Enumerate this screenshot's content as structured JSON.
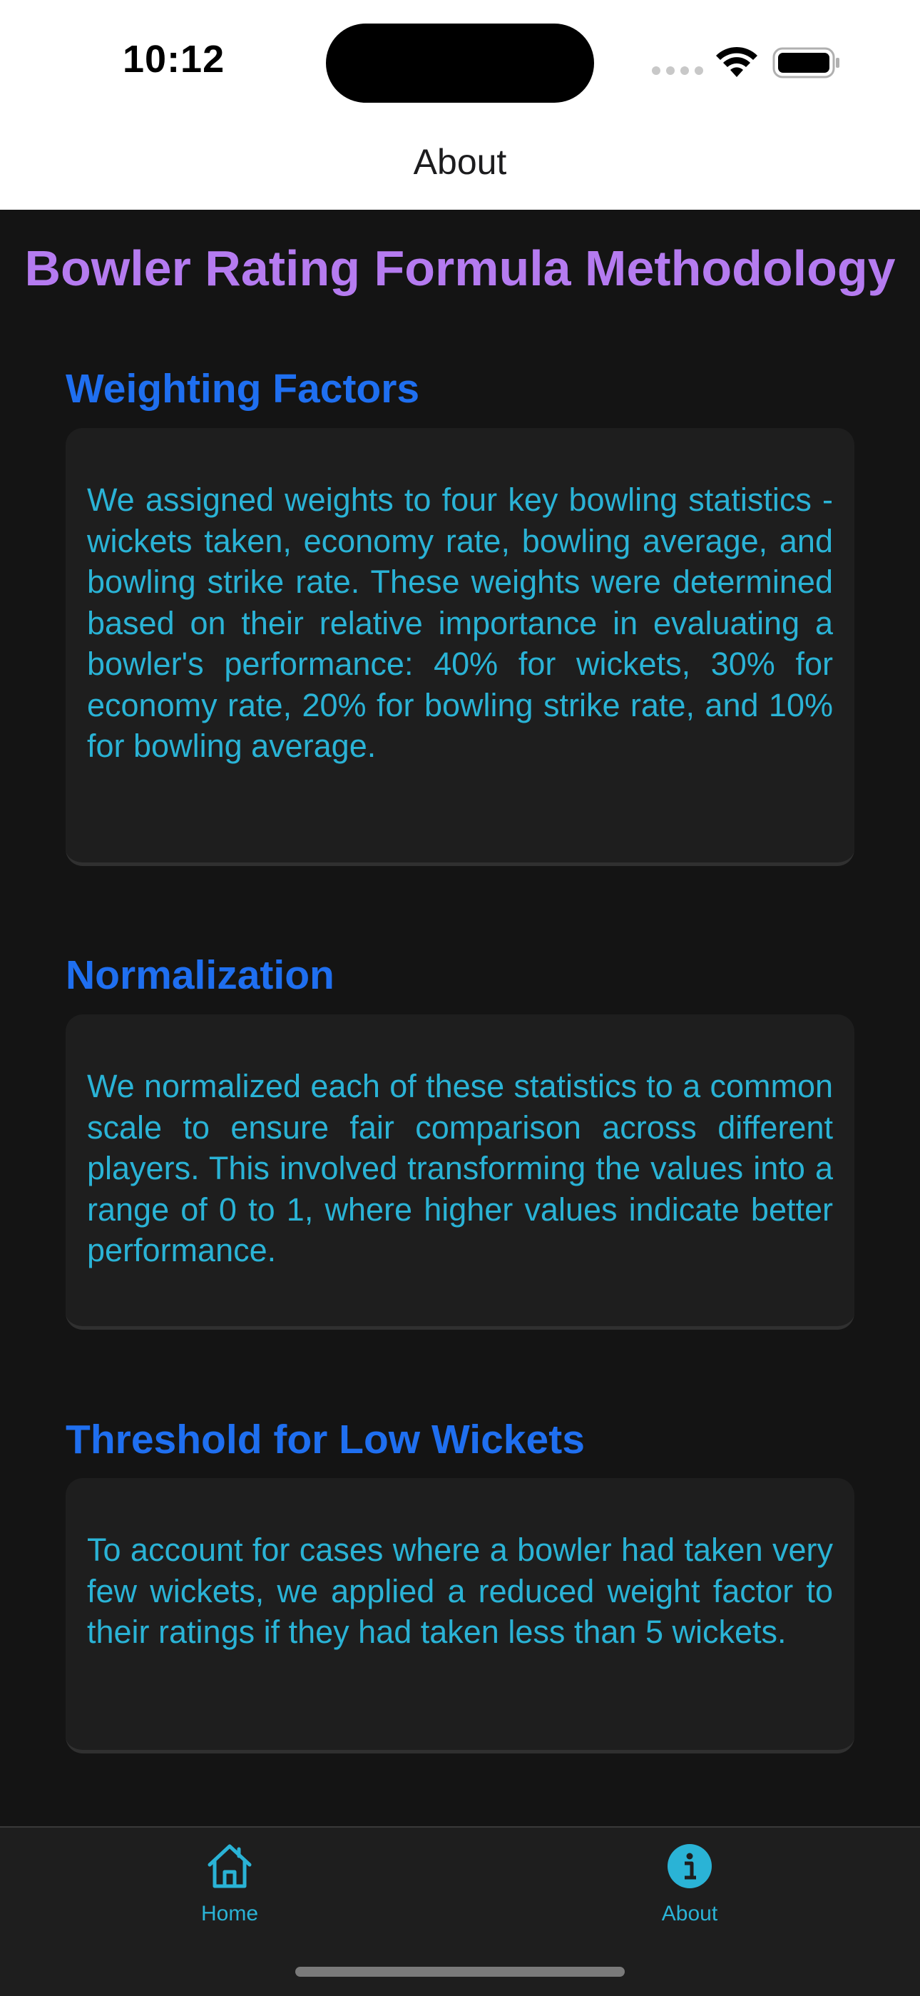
{
  "status_bar": {
    "time": "10:12"
  },
  "nav": {
    "title": "About"
  },
  "page": {
    "title": "Bowler Rating Formula Methodology"
  },
  "sections": [
    {
      "heading": "Weighting Factors",
      "body": "We assigned weights to four key bowling statistics - wickets taken, economy rate, bowling average, and bowling strike rate. These weights were determined based on their relative importance in evaluating a bowler's performance: 40% for wickets, 30% for economy rate, 20% for bowling strike rate, and 10% for bowling average."
    },
    {
      "heading": "Normalization",
      "body": "We normalized each of these statistics to a common scale to ensure fair comparison across different players. This involved transforming the values into a range of 0 to 1, where higher values indicate better performance."
    },
    {
      "heading": "Threshold for Low Wickets",
      "body": "To account for cases where a bowler had taken very few wickets, we applied a reduced weight factor to their ratings if they had taken less than 5 wickets."
    }
  ],
  "tabbar": {
    "items": [
      {
        "label": "Home",
        "icon": "house-icon"
      },
      {
        "label": "About",
        "icon": "info-circle-icon"
      }
    ]
  },
  "colors": {
    "title": "#b57bf0",
    "heading": "#1f6ff0",
    "body_text": "#2ab3d6",
    "background": "#141414",
    "card": "#1e1e1e"
  }
}
